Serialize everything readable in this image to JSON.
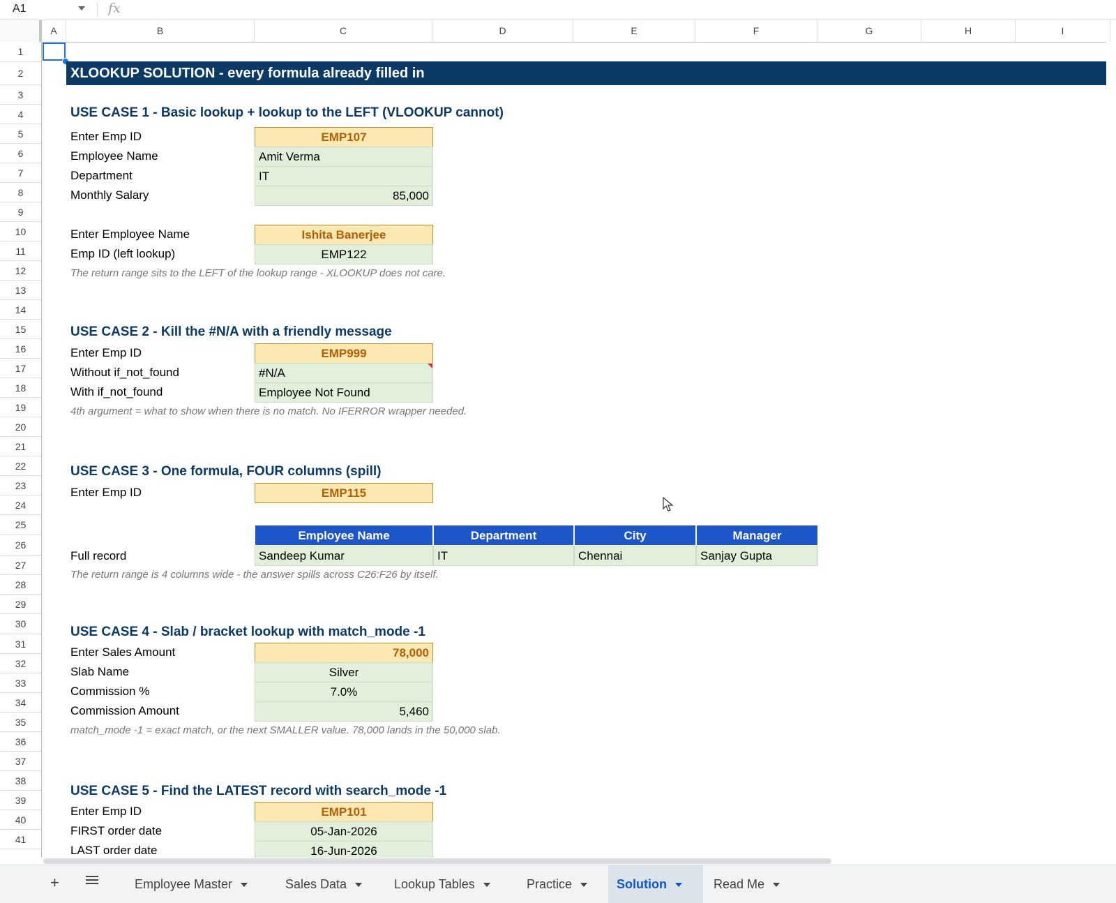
{
  "formula_bar": {
    "cell_ref": "A1",
    "fx": "fx"
  },
  "columns": [
    "A",
    "B",
    "C",
    "D",
    "E",
    "F",
    "G",
    "H",
    "I"
  ],
  "rows": [
    "1",
    "2",
    "3",
    "4",
    "5",
    "6",
    "7",
    "8",
    "9",
    "10",
    "11",
    "12",
    "13",
    "14",
    "15",
    "16",
    "17",
    "18",
    "19",
    "20",
    "21",
    "22",
    "23",
    "24",
    "25",
    "26",
    "27",
    "28",
    "29",
    "30",
    "31",
    "32",
    "33",
    "34",
    "35",
    "36",
    "37",
    "38",
    "39",
    "40",
    "41"
  ],
  "sheet": {
    "title": "XLOOKUP SOLUTION  -  every formula already filled in",
    "uc1": {
      "heading": "USE CASE 1  -  Basic lookup + lookup to the LEFT (VLOOKUP cannot)",
      "l_empid": "Enter Emp ID",
      "v_empid": "EMP107",
      "l_name": "Employee Name",
      "v_name": "Amit Verma",
      "l_dept": "Department",
      "v_dept": "IT",
      "l_salary": "Monthly Salary",
      "v_salary": "85,000",
      "l_ename": "Enter Employee Name",
      "v_ename": "Ishita Banerjee",
      "l_left": "Emp ID  (left lookup)",
      "v_left": "EMP122",
      "note": "The return range sits to the LEFT of the lookup range - XLOOKUP does not care."
    },
    "uc2": {
      "heading": "USE CASE 2  -  Kill the #N/A with a friendly message",
      "l_empid": "Enter Emp ID",
      "v_empid": "EMP999",
      "l_without": "Without if_not_found",
      "v_without": "#N/A",
      "l_with": "With if_not_found",
      "v_with": "Employee Not Found",
      "note": "4th argument = what to show when there is no match. No IFERROR wrapper needed."
    },
    "uc3": {
      "heading": "USE CASE 3  -  One formula, FOUR columns (spill)",
      "l_empid": "Enter Emp ID",
      "v_empid": "EMP115",
      "headers": [
        "Employee Name",
        "Department",
        "City",
        "Manager"
      ],
      "l_record": "Full record",
      "record": [
        "Sandeep Kumar",
        "IT",
        "Chennai",
        "Sanjay Gupta"
      ],
      "note": "The return range is 4 columns wide - the answer spills across C26:F26 by itself."
    },
    "uc4": {
      "heading": "USE CASE 4  -  Slab / bracket lookup with match_mode -1",
      "l_sales": "Enter Sales Amount",
      "v_sales": "78,000",
      "l_slab": "Slab Name",
      "v_slab": "Silver",
      "l_pct": "Commission %",
      "v_pct": "7.0%",
      "l_amt": "Commission Amount",
      "v_amt": "5,460",
      "note": "match_mode -1 = exact match, or the next SMALLER value. 78,000 lands in the 50,000 slab."
    },
    "uc5": {
      "heading": "USE CASE 5  -  Find the LATEST record with search_mode -1",
      "l_empid": "Enter Emp ID",
      "v_empid": "EMP101",
      "l_first": "FIRST order date",
      "v_first": "05-Jan-2026",
      "l_last": "LAST order date",
      "v_last": "16-Jun-2026"
    }
  },
  "tabs": [
    {
      "label": "Employee Master"
    },
    {
      "label": "Sales Data"
    },
    {
      "label": "Lookup Tables"
    },
    {
      "label": "Practice"
    },
    {
      "label": "Solution",
      "active": true
    },
    {
      "label": "Read Me"
    }
  ],
  "colors": {
    "title_bg": "#0b3a66",
    "input_bg": "#fce8b2",
    "output_bg": "#e2efda",
    "table_header_bg": "#1c56c9",
    "active_tab": "#0b57d0"
  }
}
